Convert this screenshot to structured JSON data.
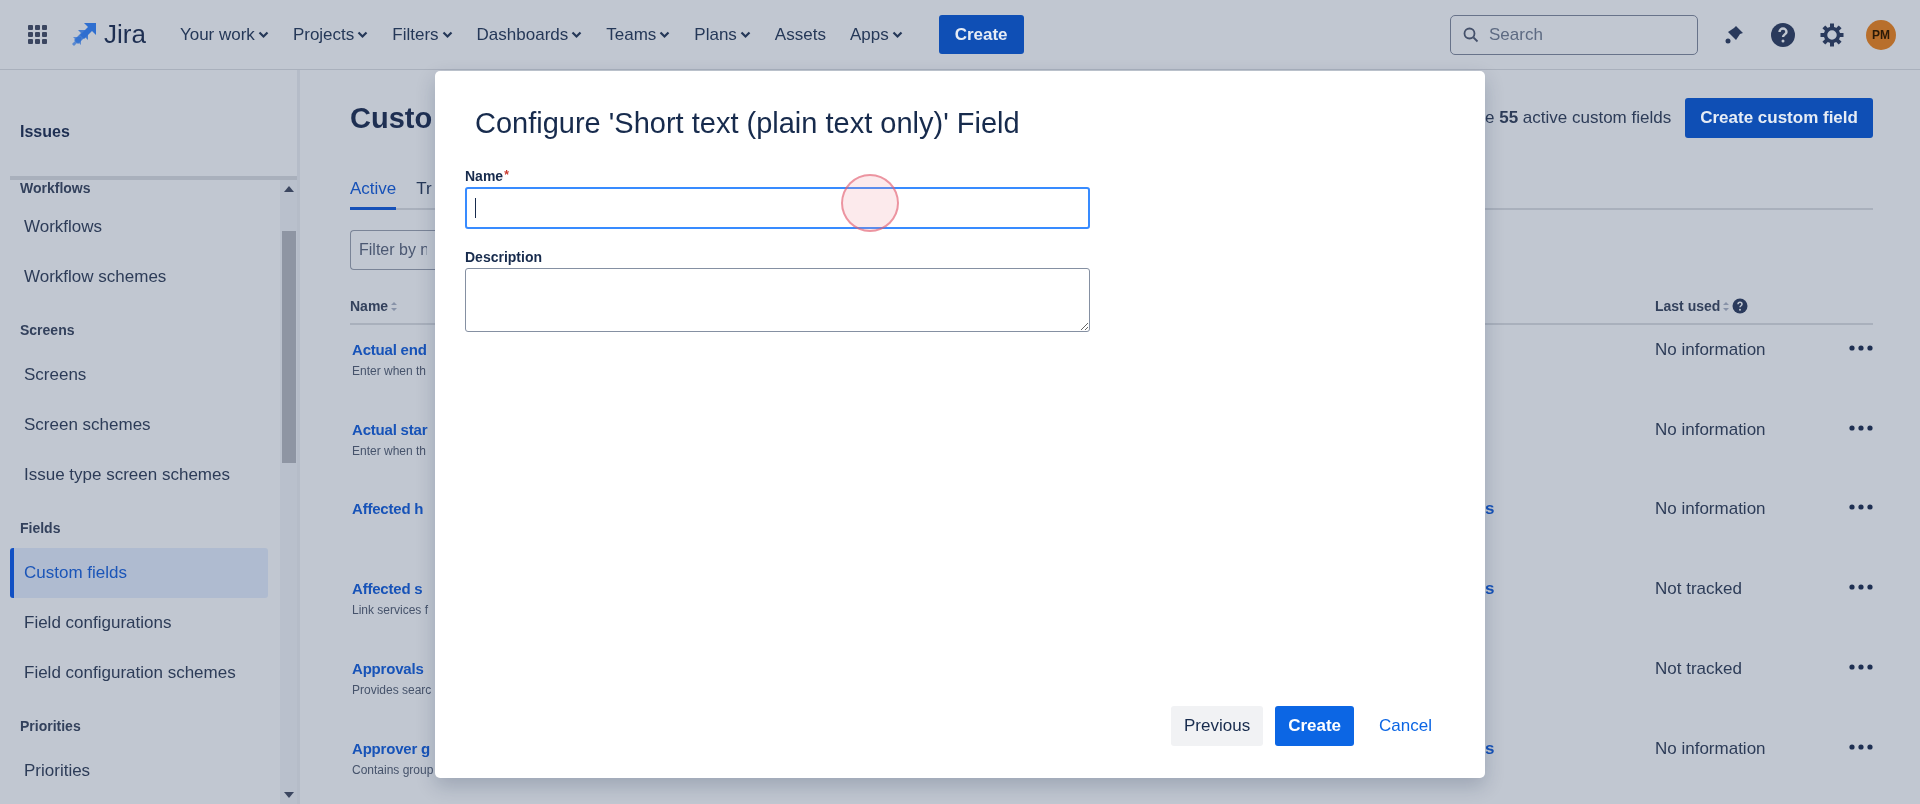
{
  "top_nav": {
    "logo": "Jira",
    "items": [
      {
        "label": "Your work",
        "dropdown": true
      },
      {
        "label": "Projects",
        "dropdown": true
      },
      {
        "label": "Filters",
        "dropdown": true
      },
      {
        "label": "Dashboards",
        "dropdown": true
      },
      {
        "label": "Teams",
        "dropdown": true
      },
      {
        "label": "Plans",
        "dropdown": true
      },
      {
        "label": "Assets",
        "dropdown": false
      },
      {
        "label": "Apps",
        "dropdown": true
      }
    ],
    "create_button": "Create",
    "search": {
      "placeholder": "Search"
    },
    "avatar": "PM"
  },
  "sidebar": {
    "title": "Issues",
    "sections": [
      {
        "heading": "Workflows",
        "items": [
          {
            "label": "Workflows",
            "selected": false
          },
          {
            "label": "Workflow schemes",
            "selected": false
          }
        ]
      },
      {
        "heading": "Screens",
        "items": [
          {
            "label": "Screens",
            "selected": false
          },
          {
            "label": "Screen schemes",
            "selected": false
          },
          {
            "label": "Issue type screen schemes",
            "selected": false
          }
        ]
      },
      {
        "heading": "Fields",
        "items": [
          {
            "label": "Custom fields",
            "selected": true
          },
          {
            "label": "Field configurations",
            "selected": false
          },
          {
            "label": "Field configuration schemes",
            "selected": false
          }
        ]
      },
      {
        "heading": "Priorities",
        "items": [
          {
            "label": "Priorities",
            "selected": false
          }
        ]
      }
    ]
  },
  "page": {
    "title": "Custo",
    "summary": "e **55** active custom fields",
    "create_button": "Create custom field",
    "tabs": [
      {
        "label": "Active",
        "selected": true
      },
      {
        "label": "Tr",
        "selected": false
      }
    ],
    "filter": {
      "placeholder": "Filter by n"
    },
    "columns": [
      {
        "label": "Name"
      },
      {
        "label": "Last used"
      }
    ],
    "rows": [
      {
        "name": "Actual end",
        "description": "Enter when th",
        "last_used": "No information"
      },
      {
        "name": "Actual star",
        "description": "Enter when th",
        "last_used": "No information"
      },
      {
        "name": "Affected h",
        "column_3": "s",
        "last_used": "No information"
      },
      {
        "name": "Affected s",
        "description": "Link services f",
        "column_3": "s",
        "last_used": "Not tracked"
      },
      {
        "name": "Approvals",
        "description": "Provides searc",
        "last_used": "Not tracked"
      },
      {
        "name": "Approver g",
        "description": "Contains group",
        "column_3": "s",
        "last_used": "No information"
      }
    ]
  },
  "dialog": {
    "title": "Configure 'Short text (plain text only)' Field",
    "fields": [
      {
        "label": "Name",
        "required_mark": "*",
        "kind": "input",
        "focused": true
      },
      {
        "label": "Description",
        "kind": "textarea",
        "focused": false
      }
    ],
    "buttons": [
      {
        "label": "Previous",
        "kind": "secondary"
      },
      {
        "label": "Create",
        "kind": "primary"
      },
      {
        "label": "Cancel",
        "kind": "link"
      }
    ]
  }
}
